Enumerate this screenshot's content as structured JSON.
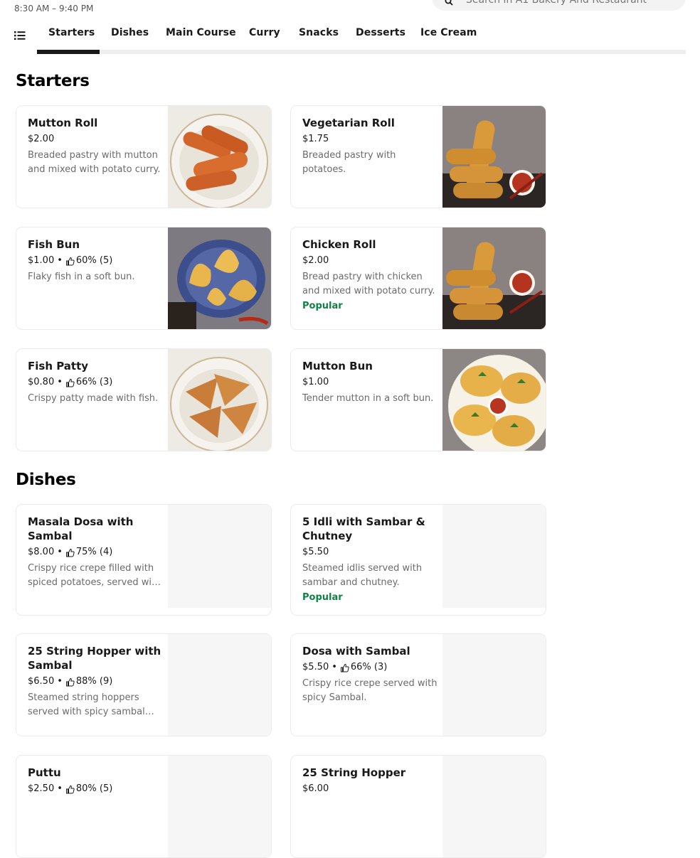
{
  "store": {
    "hours": "8:30 AM – 9:40 PM",
    "search_placeholder": "Search in A1 Bakery And Restaurant"
  },
  "tabs": [
    {
      "label": "Starters",
      "active": true
    },
    {
      "label": "Dishes"
    },
    {
      "label": "Main Course"
    },
    {
      "label": "Curry"
    },
    {
      "label": "Snacks"
    },
    {
      "label": "Desserts"
    },
    {
      "label": "Ice Cream"
    }
  ],
  "sections": [
    {
      "title": "Starters",
      "items": [
        {
          "name": "Mutton Roll",
          "price": "$2.00",
          "desc": "Breaded pastry with mutton and mixed with potato curry.",
          "image": "rolls-bowl"
        },
        {
          "name": "Vegetarian Roll",
          "price": "$1.75",
          "desc": "Breaded pastry with potatoes.",
          "image": "rolls-sauce"
        },
        {
          "name": "Fish Bun",
          "price": "$1.00",
          "rating": "60% (5)",
          "desc": "Flaky fish in a soft bun.",
          "image": "buns-plate"
        },
        {
          "name": "Chicken Roll",
          "price": "$2.00",
          "desc": "Bread pastry with chicken and mixed with potato curry.",
          "badge": "Popular",
          "image": "rolls-sauce"
        },
        {
          "name": "Fish Patty",
          "price": "$0.80",
          "rating": "66% (3)",
          "desc": "Crispy patty made with fish.",
          "image": "patties-bowl"
        },
        {
          "name": "Mutton Bun",
          "price": "$1.00",
          "desc": "Tender mutton in a soft bun.",
          "image": "buns-sauce"
        }
      ]
    },
    {
      "title": "Dishes",
      "items": [
        {
          "name": "Masala Dosa with Sambal",
          "price": "$8.00",
          "rating": "75% (4)",
          "desc": "Crispy rice crepe filled with spiced potatoes, served with spicy sambal."
        },
        {
          "name": "5 Idli with Sambar & Chutney",
          "price": "$5.50",
          "desc": "Steamed idlis served with sambar and chutney.",
          "badge": "Popular"
        },
        {
          "name": "25 String Hopper with Sambal",
          "price": "$6.50",
          "rating": "88% (9)",
          "desc": "Steamed string hoppers served with spicy sambal and curry."
        },
        {
          "name": "Dosa with Sambal",
          "price": "$5.50",
          "rating": "66% (3)",
          "desc": "Crispy rice crepe served with spicy Sambal."
        },
        {
          "name": "Puttu",
          "price": "$2.50",
          "rating": "80% (5)",
          "desc": ""
        },
        {
          "name": "25 String Hopper",
          "price": "$6.00",
          "desc": ""
        }
      ]
    }
  ],
  "colors": {
    "popular": "#0e8345",
    "text": "#191919",
    "muted": "#6b6b6b"
  }
}
